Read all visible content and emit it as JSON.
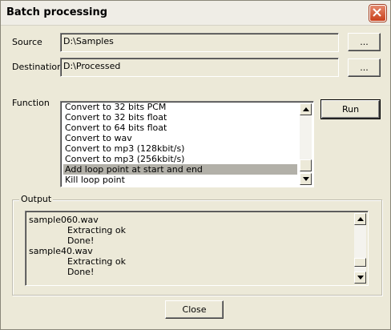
{
  "window": {
    "title": "Batch processing"
  },
  "source": {
    "label": "Source",
    "value": "D:\\Samples",
    "browse_label": "..."
  },
  "destination": {
    "label": "Destination",
    "value": "D:\\Processed",
    "browse_label": "..."
  },
  "function": {
    "label": "Function",
    "items": [
      "Convert to 32 bits PCM",
      "Convert to 32 bits float",
      "Convert to 64 bits float",
      "Convert to wav",
      "Convert to mp3 (128kbit/s)",
      "Convert to mp3 (256kbit/s)",
      "Add loop point at start and end",
      "Kill loop point"
    ],
    "selected_index": 6,
    "run_label": "Run"
  },
  "output": {
    "label": "Output",
    "lines": [
      {
        "text": "sample060.wav",
        "indent": false
      },
      {
        "text": "Extracting ok",
        "indent": true
      },
      {
        "text": "Done!",
        "indent": true
      },
      {
        "text": "sample40.wav",
        "indent": false
      },
      {
        "text": "Extracting ok",
        "indent": true
      },
      {
        "text": "Done!",
        "indent": true
      }
    ]
  },
  "close_label": "Close"
}
